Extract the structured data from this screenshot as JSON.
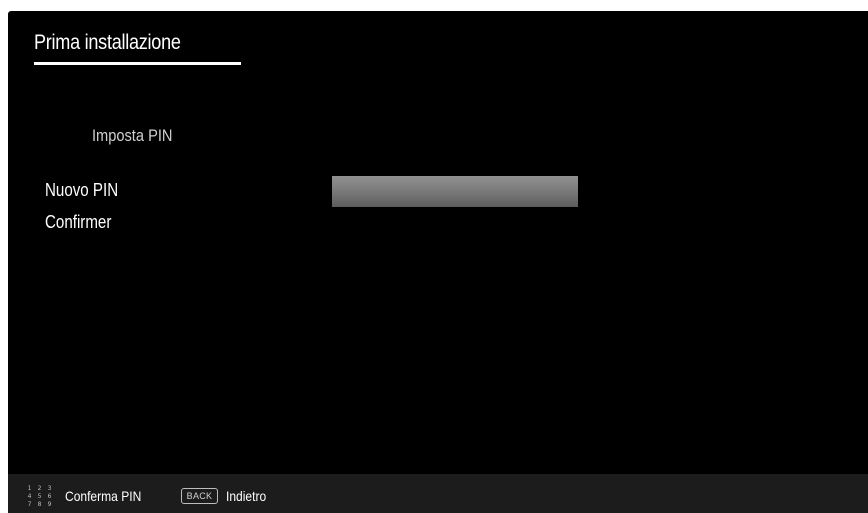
{
  "header": {
    "title": "Prima installazione"
  },
  "pin_setup": {
    "subtitle": "Imposta PIN",
    "new_pin_label": "Nuovo PIN",
    "confirm_label": "Confirmer",
    "new_pin_value": ""
  },
  "footer": {
    "keypad_digits": [
      "1",
      "2",
      "3",
      "4",
      "5",
      "6",
      "7",
      "8",
      "9"
    ],
    "confirm_pin_label": "Conferma PIN",
    "back_key": "BACK",
    "back_label": "Indietro"
  },
  "colors": {
    "background": "#000000",
    "footer_background": "#1c1c1c",
    "text": "#ffffff",
    "field_gradient_top": "#909090",
    "field_gradient_bottom": "#5c5c5c"
  }
}
